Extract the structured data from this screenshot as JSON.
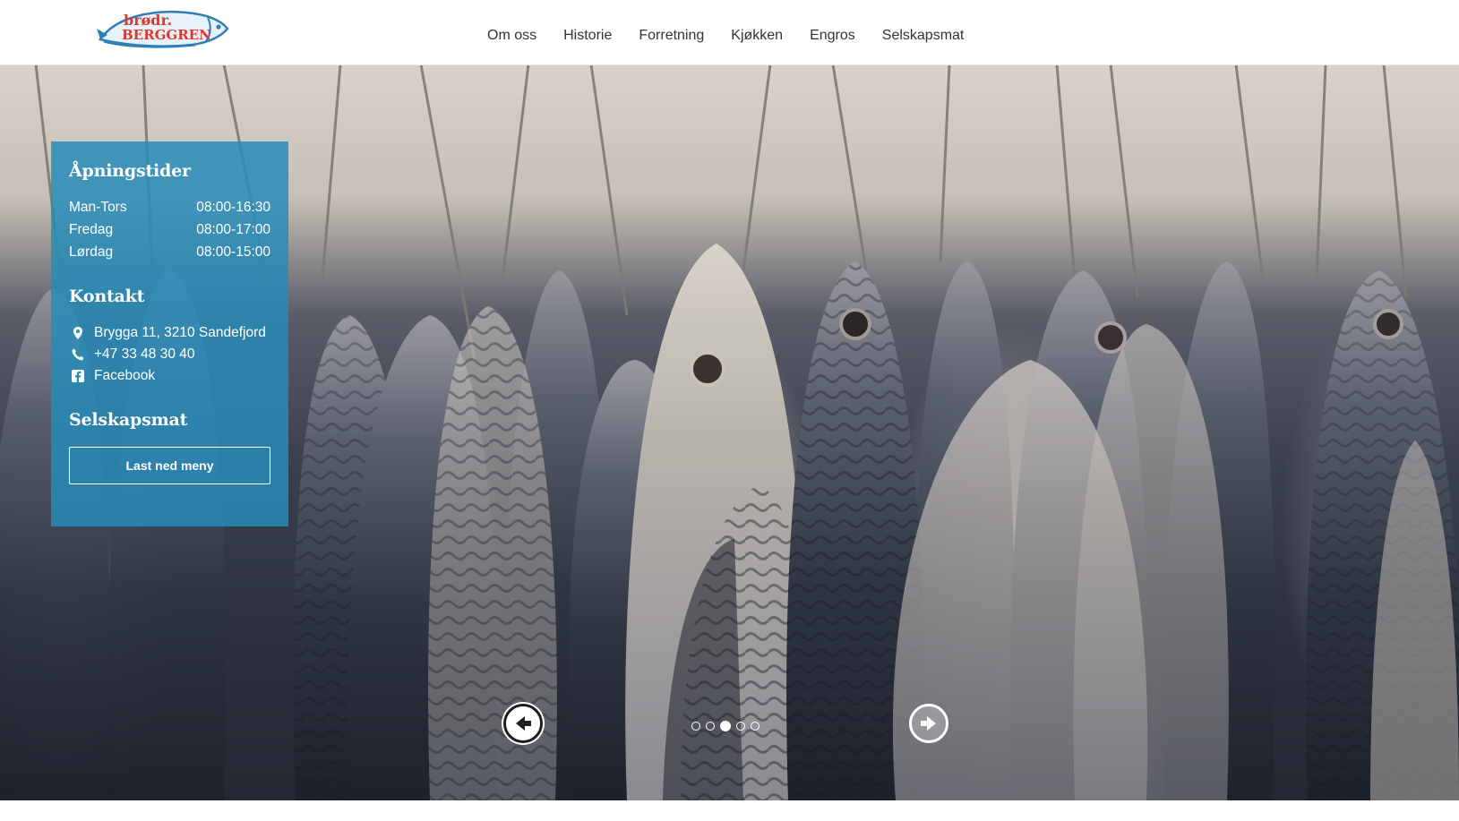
{
  "header": {
    "logo": {
      "alt": "Brødr. Berggren",
      "line1": "brødr.",
      "line2": "BERGGREN"
    },
    "nav": [
      "Om oss",
      "Historie",
      "Forretning",
      "Kjøkken",
      "Engros",
      "Selskapsmat"
    ]
  },
  "info_panel": {
    "hours_title": "Åpningstider",
    "hours": [
      {
        "day": "Man-Tors",
        "time": "08:00-16:30"
      },
      {
        "day": "Fredag",
        "time": "08:00-17:00"
      },
      {
        "day": "Lørdag",
        "time": "08:00-15:00"
      }
    ],
    "contact_title": "Kontakt",
    "contact": {
      "address": "Brygga 11, 3210 Sandefjord",
      "phone": "+47 33 48 30 40",
      "facebook": "Facebook"
    },
    "catering_title": "Selskapsmat",
    "download_button": "Last ned meny"
  },
  "slider": {
    "slide_count": 5,
    "active_index": 2,
    "prev_icon": "arrow-left-circle-icon",
    "next_icon": "arrow-right-circle-icon"
  },
  "colors": {
    "panel": "#268cb9",
    "logo_red": "#d93a2e",
    "logo_blue": "#2f7fb5",
    "nav_text": "#333333"
  }
}
